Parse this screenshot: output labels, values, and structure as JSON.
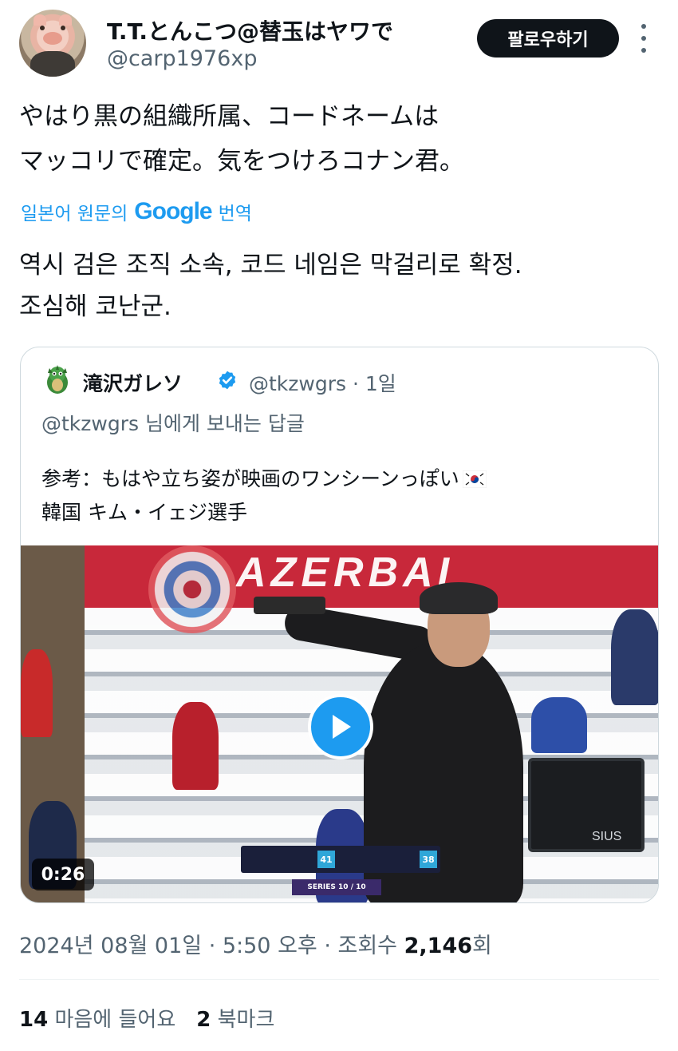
{
  "author": {
    "display_name": "T.T.とんこつ@替玉はヤワで",
    "handle": "@carp1976xp",
    "follow_label": "팔로우하기"
  },
  "tweet": {
    "lines": [
      "やはり黒の組織所属、コードネームは",
      "マッコリで確定。気をつけろコナン君。"
    ],
    "translate_prefix": "일본어 원문의",
    "translate_brand": "Google",
    "translate_suffix": "번역",
    "translated_lines": [
      "역시 검은 조직 소속, 코드 네임은 막걸리로 확정.",
      "조심해 코난군."
    ]
  },
  "quote": {
    "display_name": "滝沢ガレソ",
    "handle_time": "@tkzwgrs · 1일",
    "reply_to": "@tkzwgrs 님에게 보내는 답글",
    "lines": [
      "参考：もはや立ち姿が映画のワンシーンっぽい",
      "韓国 キム・イェジ選手"
    ],
    "video": {
      "banner": "AZERBAI",
      "duration": "0:26",
      "score_left": "41",
      "score_right": "38",
      "series": "SERIES 10 / 10",
      "monitor_label": "SIUS"
    }
  },
  "meta": {
    "timestamp": "2024년 08월 01일 · 5:50 오후 · 조회수",
    "views": "2,146",
    "views_suffix": "회"
  },
  "stats": {
    "likes_count": "14",
    "likes_label": "마음에 들어요",
    "bookmarks_count": "2",
    "bookmarks_label": "북마크"
  },
  "colors": {
    "accent": "#1d9bf0",
    "text": "#0f1419",
    "secondary": "#536471",
    "border": "#cfd9de"
  }
}
